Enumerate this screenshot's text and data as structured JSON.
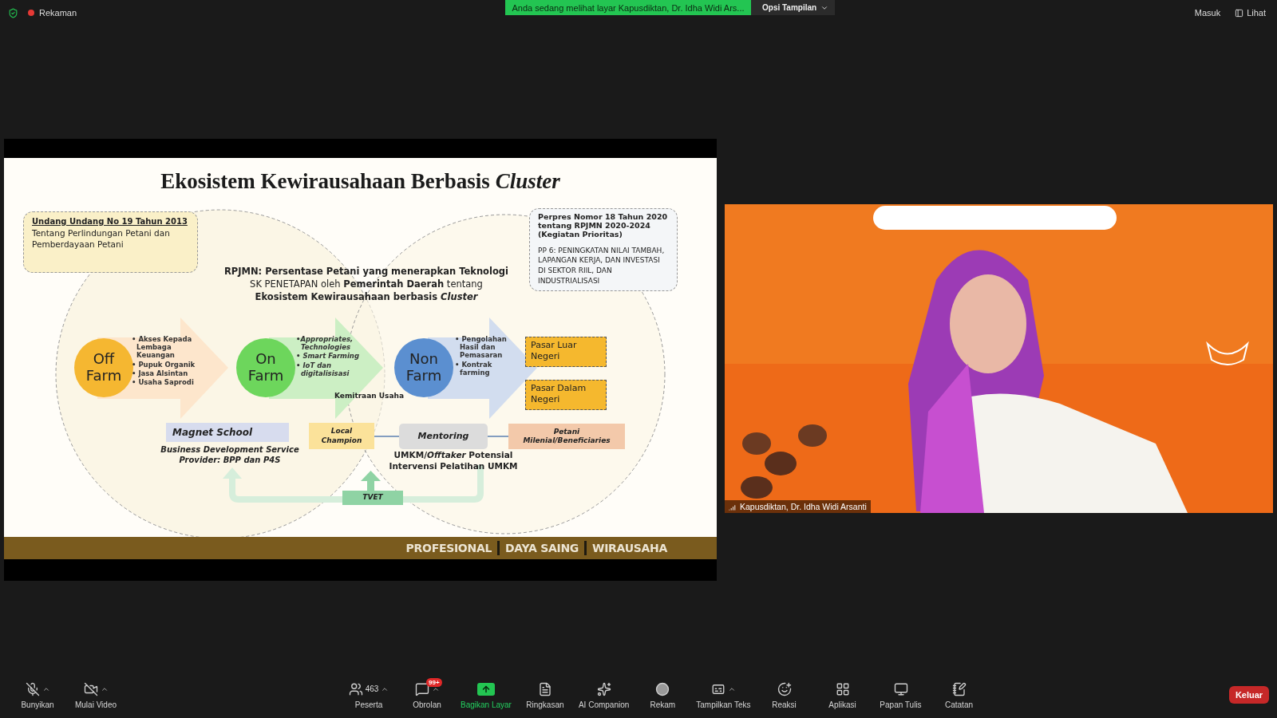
{
  "top_bar": {
    "recording_label": "Rekaman",
    "share_banner": "Anda sedang melihat layar Kapusdiktan, Dr. Idha Widi Ars...",
    "view_options": "Opsi Tampilan",
    "right_buttons": [
      {
        "kind": "signin",
        "label": "Masuk"
      },
      {
        "kind": "view",
        "label": "Lihat"
      }
    ]
  },
  "slide": {
    "title": "Ekosistem Kewirausahaan Berbasis *Cluster*",
    "law_box": {
      "heading": "Undang Undang No 19 Tahun 2013",
      "body": "Tentang Perlindungan Petani dan Pemberdayaan Petani"
    },
    "perpres_box": {
      "heading": "Perpres Nomor 18 Tahun 2020 tentang RPJMN 2020-2024 (Kegiatan Prioritas)",
      "body": "PP 6: PENINGKATAN NILAI TAMBAH, LAPANGAN KERJA, DAN INVESTASI DI SEKTOR RIIL, DAN INDUSTRIALISASI"
    },
    "center_lines": [
      {
        "text": "RPJMN: Persentase Petani yang menerapkan Teknologi",
        "bold": true
      },
      {
        "text": "SK PENETAPAN oleh **Pemerintah Daerah** tentang",
        "bold": false
      },
      {
        "text": "Ekosistem Kewirausahaan berbasis *Cluster*",
        "bold": true
      }
    ],
    "stages": [
      {
        "label": "Off Farm",
        "color": "#f5b731",
        "bullets": [
          "• Akses Kepada Lembaga Keuangan",
          "• Pupuk Organik",
          "• Jasa Alsintan",
          "• Usaha Saprodi"
        ]
      },
      {
        "label": "On Farm",
        "color": "#6dd65c",
        "bullets": [
          "•Appropriates, Technologies",
          "• Smart Farming",
          "• IoT dan digitalisisasi"
        ]
      },
      {
        "label": "Non Farm",
        "color": "#5b8fd0",
        "bullets": [
          "• Pengolahan Hasil dan Pemasaran",
          "• Kontrak farming"
        ]
      }
    ],
    "markets": [
      "Pasar Luar Negeri",
      "Pasar Dalam Negeri"
    ],
    "partnership_label": "Kemitraan Usaha",
    "magnet_school": "Magnet School",
    "service_provider": "Business Development Service Provider: BPP dan P4S",
    "local_champion": "Local Champion",
    "mentoring": "Mentoring",
    "beneficiaries": "Petani Milenial/Beneficiaries",
    "umkm_text": "UMKM/*Offtaker* Potensial Intervensi Pelatihan UMKM",
    "tvet": "TVET",
    "tagline": [
      "PROFESIONAL",
      "DAYA SAING",
      "WIRAUSAHA"
    ]
  },
  "video": {
    "kind": "picture",
    "participant_name": "Kapusdiktan, Dr. Idha Widi Arsanti"
  },
  "toolbar": [
    {
      "kind": "mic",
      "label": "Bunyikan",
      "menu": true,
      "active": false
    },
    {
      "kind": "video",
      "label": "Mulai Video",
      "menu": true,
      "active": false
    },
    {
      "kind": "participants",
      "label": "Peserta",
      "count": "463",
      "menu": true,
      "active": false
    },
    {
      "kind": "chat",
      "label": "Obrolan",
      "badge": "99+",
      "menu": true,
      "active": false
    },
    {
      "kind": "share",
      "label": "Bagikan Layar",
      "menu": false,
      "active": true
    },
    {
      "kind": "summary",
      "label": "Ringkasan",
      "menu": false,
      "active": false
    },
    {
      "kind": "ai",
      "label": "AI Companion",
      "menu": false,
      "active": false
    },
    {
      "kind": "record",
      "label": "Rekam",
      "menu": false,
      "active": false
    },
    {
      "kind": "captions",
      "label": "Tampilkan Teks",
      "menu": true,
      "active": false
    },
    {
      "kind": "reactions",
      "label": "Reaksi",
      "menu": false,
      "active": false
    },
    {
      "kind": "apps",
      "label": "Aplikasi",
      "menu": false,
      "active": false
    },
    {
      "kind": "whiteboard",
      "label": "Papan Tulis",
      "menu": false,
      "active": false
    },
    {
      "kind": "notes",
      "label": "Catatan",
      "menu": false,
      "active": false
    }
  ],
  "leave_button": "Keluar"
}
